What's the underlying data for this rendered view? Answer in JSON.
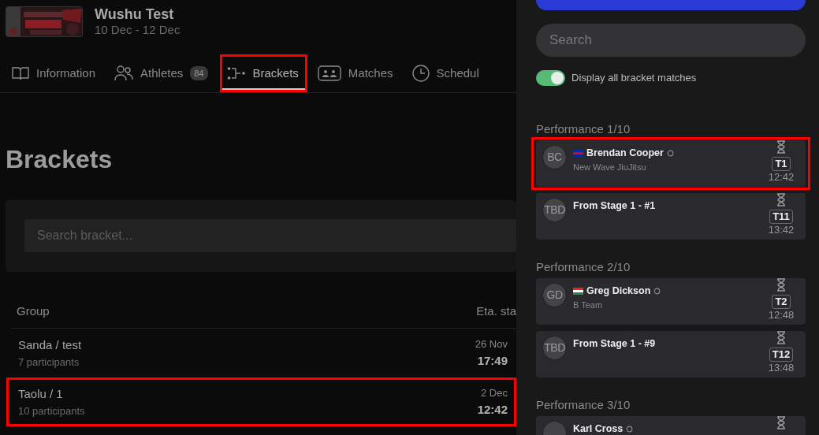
{
  "event": {
    "title": "Wushu Test",
    "dates": "10 Dec - 12 Dec"
  },
  "tabs": [
    {
      "label": "Information",
      "selected": false,
      "highlighted": false
    },
    {
      "label": "Athletes",
      "badge": "84",
      "selected": false,
      "highlighted": false
    },
    {
      "label": "Brackets",
      "selected": true,
      "highlighted": true
    },
    {
      "label": "Matches",
      "selected": false,
      "highlighted": false
    },
    {
      "label": "Schedul",
      "selected": false,
      "highlighted": false
    }
  ],
  "heading": "Brackets",
  "bracket_search": {
    "placeholder": "Search bracket..."
  },
  "table": {
    "columns": [
      "Group",
      "Eta. sta"
    ],
    "rows": [
      {
        "group": "Sanda / test",
        "participants": "7 participants",
        "date": "26 Nov",
        "time": "17:49",
        "highlighted": false
      },
      {
        "group": "Taolu / 1",
        "participants": "10 participants",
        "date": "2 Dec",
        "time": "12:42",
        "highlighted": true
      }
    ]
  },
  "sidebar": {
    "search": {
      "placeholder": "Search"
    },
    "toggle": {
      "label": "Display all bracket matches",
      "on": true
    },
    "sections": [
      {
        "title": "Performance 1/10",
        "matches": [
          {
            "kind": "athlete",
            "initials": "BC",
            "name": "Brendan Cooper",
            "club": "New Wave JiuJitsu",
            "flag_stripes": [
              {
                "color": "#032ea1"
              },
              {
                "color": "#e00025"
              },
              {
                "color": "#032ea1"
              }
            ],
            "mat": "T1",
            "time": "12:42",
            "highlighted": true
          },
          {
            "kind": "pending",
            "initials": "TBD",
            "name": "From Stage 1 - #1",
            "mat": "T11",
            "time": "13:42",
            "highlighted": false
          }
        ]
      },
      {
        "title": "Performance 2/10",
        "matches": [
          {
            "kind": "athlete",
            "initials": "GD",
            "name": "Greg Dickson",
            "club": "B Team",
            "flag_stripes": [
              {
                "color": "#ed2024"
              },
              {
                "color": "#ffffff"
              },
              {
                "color": "#278e43"
              }
            ],
            "mat": "T2",
            "time": "12:48",
            "highlighted": false
          },
          {
            "kind": "pending",
            "initials": "TBD",
            "name": "From Stage 1 - #9",
            "mat": "T12",
            "time": "13:48",
            "highlighted": false
          }
        ]
      },
      {
        "title": "Performance 3/10",
        "matches": [
          {
            "kind": "athlete",
            "name": "Karl Cross",
            "highlighted": false
          }
        ]
      }
    ]
  }
}
